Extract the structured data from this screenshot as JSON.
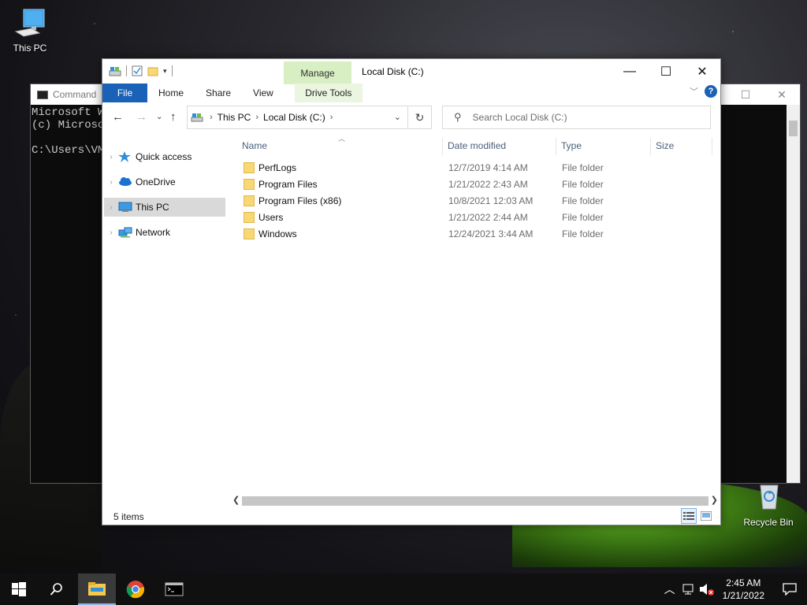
{
  "desktop": {
    "icons": [
      {
        "label": "This PC"
      },
      {
        "label": "Recycle Bin"
      }
    ]
  },
  "console": {
    "title": "Command",
    "lines": [
      "Microsoft Wi",
      "(c) Microso",
      "",
      "C:\\Users\\VM"
    ]
  },
  "explorer": {
    "title": "Local Disk (C:)",
    "manage_label": "Manage",
    "tabs": {
      "file": "File",
      "home": "Home",
      "share": "Share",
      "view": "View",
      "drive_tools": "Drive Tools"
    },
    "address": {
      "crumbs": [
        "This PC",
        "Local Disk (C:)"
      ]
    },
    "search": {
      "placeholder": "Search Local Disk (C:)"
    },
    "nav": [
      {
        "label": "Quick access",
        "icon": "star-icon"
      },
      {
        "label": "OneDrive",
        "icon": "cloud-icon"
      },
      {
        "label": "This PC",
        "icon": "computer-icon",
        "selected": true
      },
      {
        "label": "Network",
        "icon": "network-icon"
      }
    ],
    "columns": {
      "name": "Name",
      "date": "Date modified",
      "type": "Type",
      "size": "Size"
    },
    "files": [
      {
        "name": "PerfLogs",
        "date": "12/7/2019 4:14 AM",
        "type": "File folder"
      },
      {
        "name": "Program Files",
        "date": "1/21/2022 2:43 AM",
        "type": "File folder"
      },
      {
        "name": "Program Files (x86)",
        "date": "10/8/2021 12:03 AM",
        "type": "File folder"
      },
      {
        "name": "Users",
        "date": "1/21/2022 2:44 AM",
        "type": "File folder"
      },
      {
        "name": "Windows",
        "date": "12/24/2021 3:44 AM",
        "type": "File folder"
      }
    ],
    "status": "5 items"
  },
  "taskbar": {
    "clock_time": "2:45 AM",
    "clock_date": "1/21/2022"
  },
  "colors": {
    "accent": "#1a62b7",
    "manage_tab": "#d7efc2",
    "folder": "#f8d775"
  }
}
